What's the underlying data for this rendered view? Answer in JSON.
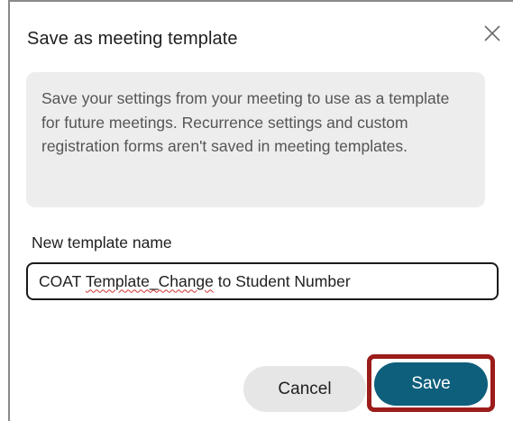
{
  "dialog": {
    "title": "Save as meeting template",
    "close_icon": "close-icon",
    "info_text": "Save your settings from your meeting to use as a template for future meetings. Recurrence settings and custom registration forms aren't saved in meeting templates.",
    "field_label": "New template name",
    "input": {
      "value_part1": "COAT ",
      "value_part2": "Template_Change",
      "value_part3": " to Student Number"
    },
    "cancel_label": "Cancel",
    "save_label": "Save"
  },
  "colors": {
    "save_button": "#0e5f7c",
    "highlight_border": "#9c1b1b",
    "info_box_bg": "#ededed"
  }
}
